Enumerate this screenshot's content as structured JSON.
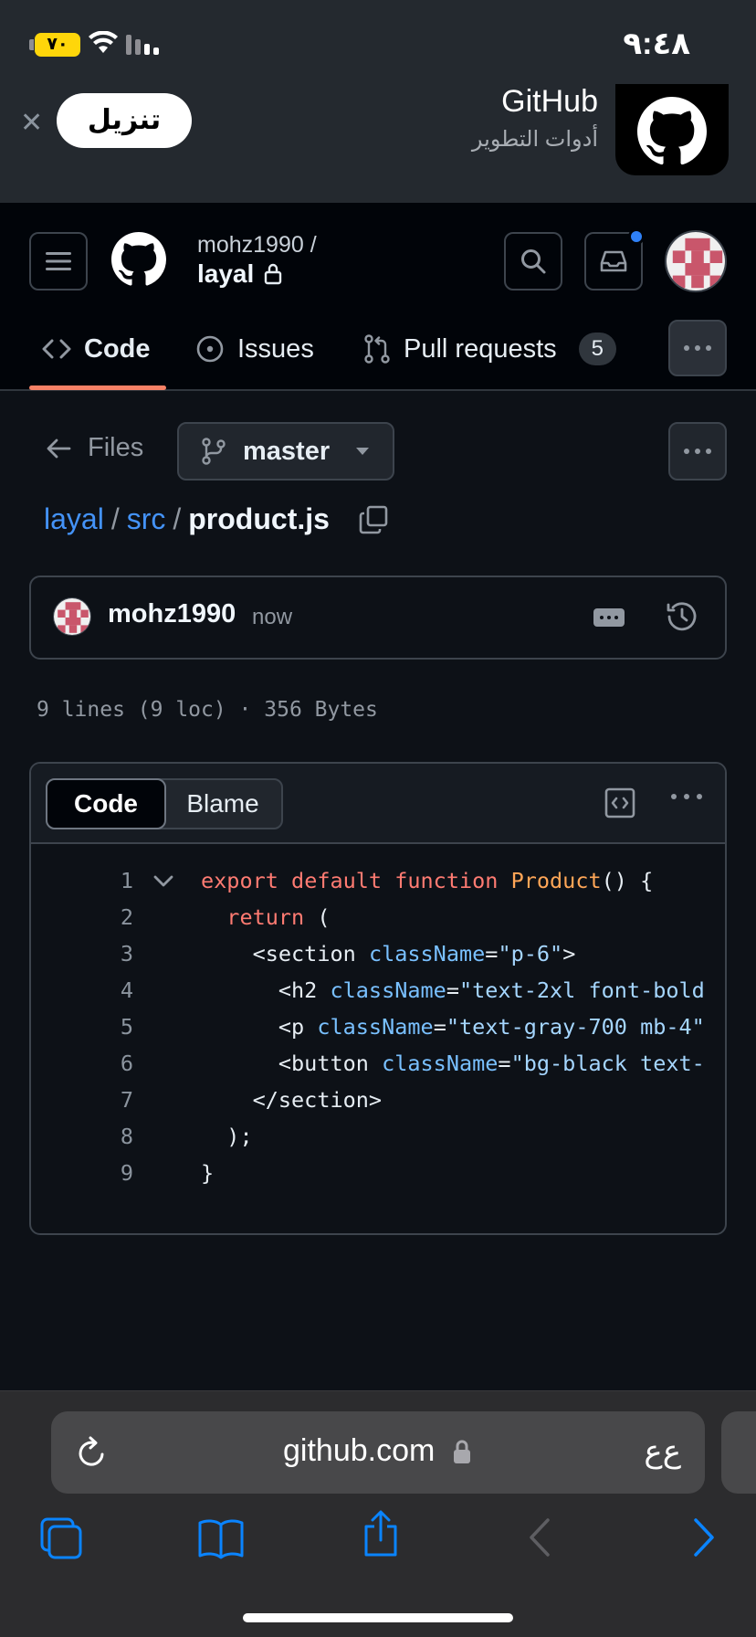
{
  "status_bar": {
    "time": "٩:٤٨",
    "battery": "٧٠"
  },
  "smart_banner": {
    "app_name": "GitHub",
    "subtitle": "أدوات التطوير",
    "download_label": "تنزيل",
    "close_glyph": "✕"
  },
  "header": {
    "owner": "mohz1990 /",
    "repo": "layal",
    "tabs": [
      {
        "label": "Code",
        "icon": "code-icon",
        "active": true
      },
      {
        "label": "Issues",
        "icon": "issue-opened-icon"
      },
      {
        "label": "Pull requests",
        "icon": "git-pull-request-icon",
        "count": "5"
      }
    ]
  },
  "file_nav": {
    "back_label": "Files",
    "branch": "master",
    "breadcrumb": {
      "repo": "layal",
      "sep": "/",
      "folder": "src",
      "file": "product.js"
    }
  },
  "commit": {
    "author": "mohz1990",
    "time": "now"
  },
  "file_meta": "9 lines (9 loc) · 356 Bytes",
  "code_view": {
    "modes": [
      "Code",
      "Blame"
    ],
    "active_mode": "Code",
    "lines": [
      {
        "n": "1",
        "tokens": [
          [
            "k",
            "export "
          ],
          [
            "k",
            "default "
          ],
          [
            "k",
            "function "
          ],
          [
            "f",
            "Product"
          ],
          [
            "t",
            "() {"
          ]
        ]
      },
      {
        "n": "2",
        "tokens": [
          [
            "t",
            "  "
          ],
          [
            "k",
            "return "
          ],
          [
            "t",
            "("
          ]
        ]
      },
      {
        "n": "3",
        "tokens": [
          [
            "t",
            "    <section "
          ],
          [
            "a",
            "className"
          ],
          [
            "t",
            "="
          ],
          [
            "s",
            "\"p-6\""
          ],
          [
            "t",
            ">"
          ]
        ]
      },
      {
        "n": "4",
        "tokens": [
          [
            "t",
            "      <h2 "
          ],
          [
            "a",
            "className"
          ],
          [
            "t",
            "="
          ],
          [
            "s",
            "\"text-2xl font-bold"
          ]
        ]
      },
      {
        "n": "5",
        "tokens": [
          [
            "t",
            "      <p "
          ],
          [
            "a",
            "className"
          ],
          [
            "t",
            "="
          ],
          [
            "s",
            "\"text-gray-700 mb-4\""
          ]
        ]
      },
      {
        "n": "6",
        "tokens": [
          [
            "t",
            "      <button "
          ],
          [
            "a",
            "className"
          ],
          [
            "t",
            "="
          ],
          [
            "s",
            "\"bg-black text-"
          ]
        ]
      },
      {
        "n": "7",
        "tokens": [
          [
            "t",
            "    </section>"
          ]
        ]
      },
      {
        "n": "8",
        "tokens": [
          [
            "t",
            "  );"
          ]
        ]
      },
      {
        "n": "9",
        "tokens": [
          [
            "t",
            "}"
          ]
        ]
      }
    ]
  },
  "safari": {
    "url": "github.com",
    "text_size": "ع‌ع"
  },
  "colors": {
    "accent_link": "#4493f8",
    "tab_underline": "#f78166",
    "keyword": "#ff7b72",
    "function": "#ffa657",
    "attribute": "#79c0ff",
    "string": "#a5d6ff",
    "notification": "#2f81f7",
    "safari_blue": "#0a84ff"
  }
}
